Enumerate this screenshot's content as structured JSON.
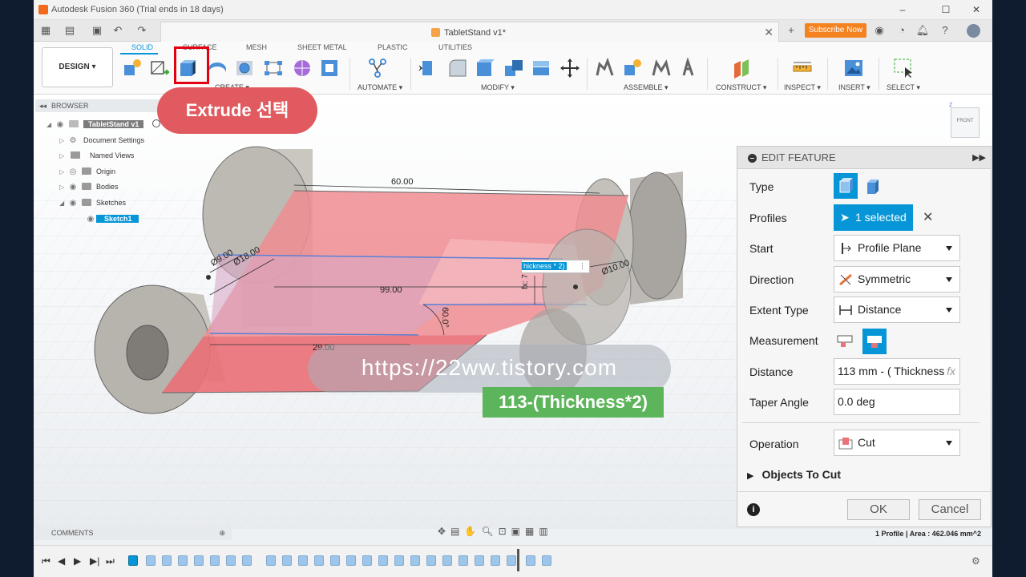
{
  "window": {
    "title": "Autodesk Fusion 360 (Trial ends in 18 days)"
  },
  "tab": {
    "name": "TabletStand v1*",
    "subscribe_label": "Subscribe Now"
  },
  "ribbon": {
    "workspace": "DESIGN ▾",
    "tabs": [
      "SOLID",
      "SURFACE",
      "MESH",
      "SHEET METAL",
      "PLASTIC",
      "UTILITIES"
    ],
    "groups": [
      "CREATE ▾",
      "AUTOMATE ▾",
      "MODIFY ▾",
      "ASSEMBLE ▾",
      "CONSTRUCT ▾",
      "INSPECT ▾",
      "INSERT ▾",
      "SELECT ▾"
    ]
  },
  "browser": {
    "title": "BROWSER",
    "items": [
      "TabletStand v1",
      "Document Settings",
      "Named Views",
      "Origin",
      "Bodies",
      "Sketches",
      "Sketch1"
    ]
  },
  "callouts": {
    "extrude": "Extrude 선택",
    "watermark": "https://22ww.tistory.com",
    "formula": "113-(Thickness*2)"
  },
  "viewcube": {
    "face": "FRONT"
  },
  "dimensions": {
    "d60": "60.00",
    "d99": "99.00",
    "d29": "29.00",
    "d9": "Ø9.00",
    "d18": "Ø18.00",
    "d10": "Ø10.00",
    "angle": "60.0°",
    "inline_input": "hickness * 2)",
    "fx": "fx: 7"
  },
  "edit_feature": {
    "title": "EDIT FEATURE",
    "type_label": "Type",
    "profiles_label": "Profiles",
    "profiles_value": "1 selected",
    "start_label": "Start",
    "start_value": "Profile Plane",
    "direction_label": "Direction",
    "direction_value": "Symmetric",
    "extent_label": "Extent Type",
    "extent_value": "Distance",
    "measurement_label": "Measurement",
    "distance_label": "Distance",
    "distance_value": "113 mm - ( Thickness",
    "taper_label": "Taper Angle",
    "taper_value": "0.0 deg",
    "operation_label": "Operation",
    "operation_value": "Cut",
    "objects_label": "Objects To Cut",
    "ok_label": "OK",
    "cancel_label": "Cancel"
  },
  "comments": {
    "label": "COMMENTS"
  },
  "status": {
    "text": "1 Profile | Area : 462.046 mm^2"
  },
  "colors": {
    "accent": "#0696d7",
    "highlight": "#e3000f",
    "callout": "#e05a5f",
    "formula": "#5cb55a",
    "body_red": "#e8737a"
  }
}
